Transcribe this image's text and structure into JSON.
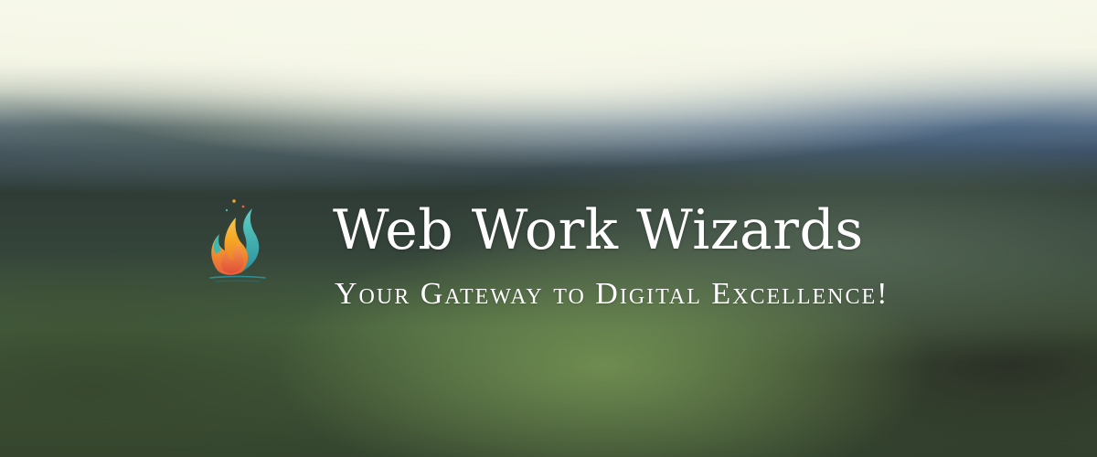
{
  "banner": {
    "title": "Web Work Wizards",
    "tagline": "Your Gateway to Digital Excellence!"
  },
  "logo": {
    "icon": "flame-icon",
    "colors": [
      "#f5a623",
      "#e8613c",
      "#3fb6b0",
      "#2a8f9b"
    ]
  },
  "colors": {
    "text": "#ffffff",
    "sky": "#f3f4e2",
    "hills": "#3e5060",
    "field": "#4a6440"
  }
}
